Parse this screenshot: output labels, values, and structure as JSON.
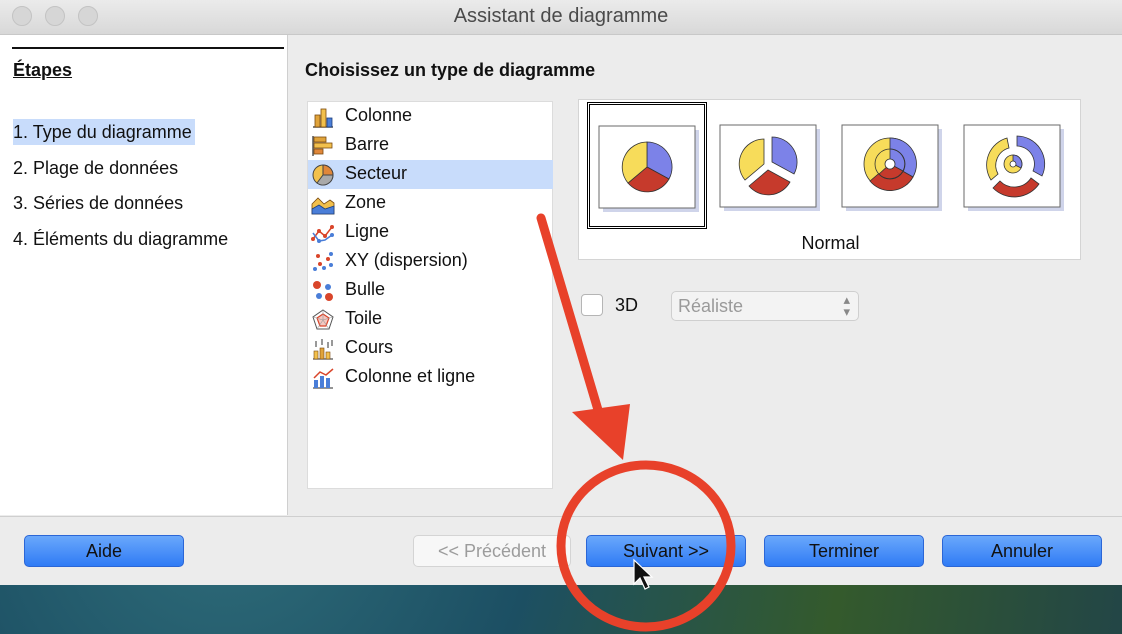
{
  "window": {
    "title": "Assistant de diagramme"
  },
  "steps": {
    "heading": "Étapes",
    "items": [
      {
        "label": "1. Type du diagramme",
        "active": true
      },
      {
        "label": "2. Plage de données",
        "active": false
      },
      {
        "label": "3. Séries de données",
        "active": false
      },
      {
        "label": "4. Éléments du diagramme",
        "active": false
      }
    ]
  },
  "main": {
    "section_title": "Choisissez un type de diagramme",
    "chart_types": [
      {
        "label": "Colonne",
        "icon": "column-chart-icon",
        "selected": false
      },
      {
        "label": "Barre",
        "icon": "bar-chart-icon",
        "selected": false
      },
      {
        "label": "Secteur",
        "icon": "pie-chart-icon",
        "selected": true
      },
      {
        "label": "Zone",
        "icon": "area-chart-icon",
        "selected": false
      },
      {
        "label": "Ligne",
        "icon": "line-chart-icon",
        "selected": false
      },
      {
        "label": "XY (dispersion)",
        "icon": "scatter-chart-icon",
        "selected": false
      },
      {
        "label": "Bulle",
        "icon": "bubble-chart-icon",
        "selected": false
      },
      {
        "label": "Toile",
        "icon": "net-chart-icon",
        "selected": false
      },
      {
        "label": "Cours",
        "icon": "stock-chart-icon",
        "selected": false
      },
      {
        "label": "Colonne et ligne",
        "icon": "column-line-chart-icon",
        "selected": false
      }
    ],
    "variants": [
      {
        "icon": "pie-normal-icon",
        "selected": true
      },
      {
        "icon": "pie-exploded-icon",
        "selected": false
      },
      {
        "icon": "donut-icon",
        "selected": false
      },
      {
        "icon": "donut-exploded-icon",
        "selected": false
      }
    ],
    "variant_caption": "Normal",
    "option_3d": {
      "label": "3D",
      "checked": false,
      "select_value": "Réaliste"
    }
  },
  "buttons": {
    "help": "Aide",
    "back": "<< Précédent",
    "next": "Suivant >>",
    "finish": "Terminer",
    "cancel": "Annuler"
  },
  "colors": {
    "selection": "#c8dcfb",
    "button_blue": "#2f7bf5",
    "pie_yellow": "#f7dc5a",
    "pie_blue": "#7c82e8",
    "pie_red": "#c63a2c",
    "annotation_red": "#e8412a"
  }
}
